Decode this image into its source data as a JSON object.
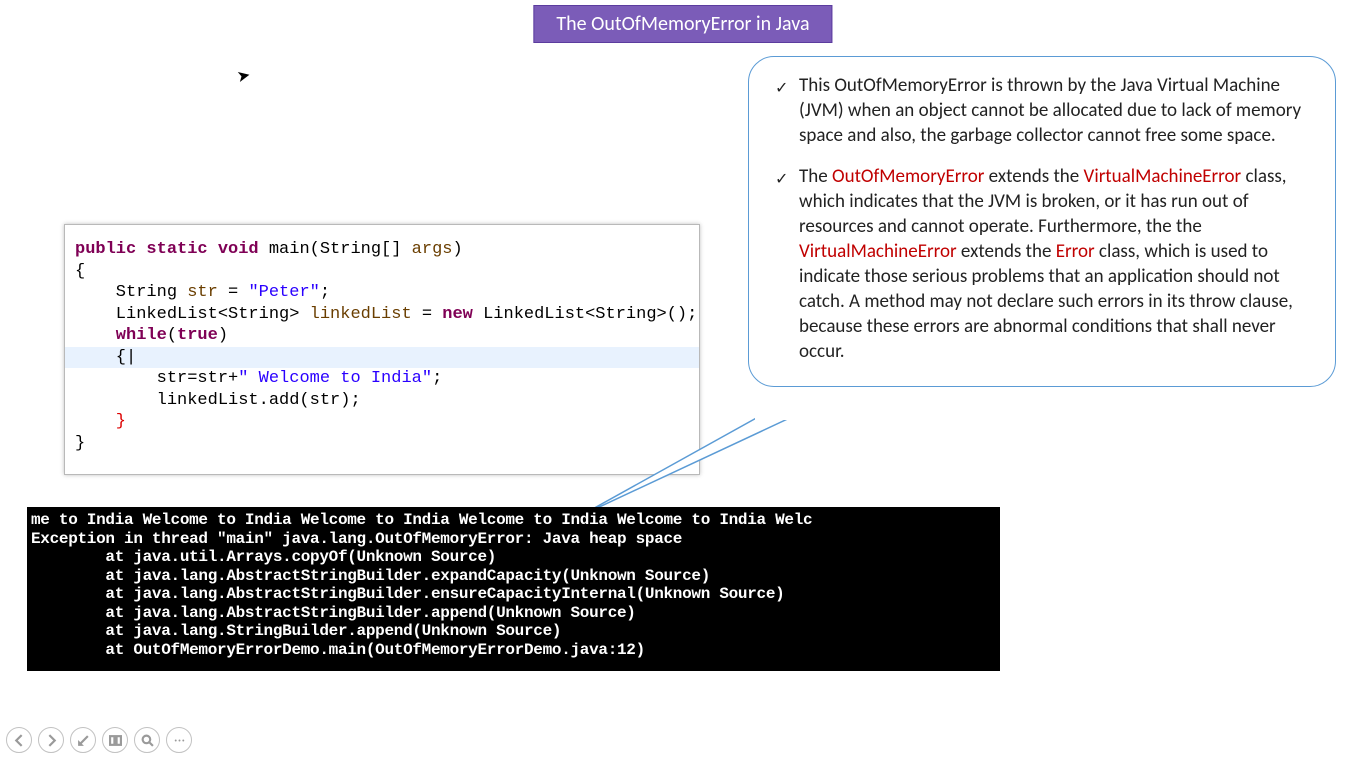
{
  "title": "The OutOfMemoryError in Java",
  "code": {
    "l1_kw": "public static void",
    "l1_b": " main(String[] ",
    "l1_par": "args",
    "l1_c": ")",
    "l2": "{",
    "l3_a": "    String ",
    "l3_par": "str",
    "l3_b": " = ",
    "l3_str": "\"Peter\"",
    "l3_c": ";",
    "l4_a": "    LinkedList<String> ",
    "l4_par": "linkedList",
    "l4_b": " = ",
    "l4_kw": "new",
    "l4_c": " LinkedList<String>();",
    "l5_kw": "    while",
    "l5_a": "(",
    "l5_kw2": "true",
    "l5_b": ")",
    "l6": "    {",
    "l7_a": "        str=str+",
    "l7_str": "\" Welcome to India\"",
    "l7_b": ";",
    "l8": "        linkedList.add(str);",
    "l9": "    }",
    "l10": "}"
  },
  "callout": {
    "p1": "This OutOfMemoryError is thrown by the Java Virtual Machine (JVM) when an object cannot be allocated due to lack of memory space and also, the garbage collector cannot free some space.",
    "p2_a": "The ",
    "p2_red1": "OutOfMemoryError",
    "p2_b": " extends the ",
    "p2_red2": "VirtualMachineError",
    "p2_c": " class, which indicates that the JVM is broken, or it has run out of resources and cannot operate. Furthermore, the the ",
    "p2_red3": "VirtualMachineError",
    "p2_d": " extends the ",
    "p2_red4": "Error",
    "p2_e": " class, which is used to indicate those serious problems that an application should not catch. A method may not declare such errors in its throw clause, because these errors are abnormal conditions that shall never occur."
  },
  "console_lines": [
    "me to India Welcome to India Welcome to India Welcome to India Welcome to India Welc",
    "Exception in thread \"main\" java.lang.OutOfMemoryError: Java heap space",
    "        at java.util.Arrays.copyOf(Unknown Source)",
    "        at java.lang.AbstractStringBuilder.expandCapacity(Unknown Source)",
    "        at java.lang.AbstractStringBuilder.ensureCapacityInternal(Unknown Source)",
    "        at java.lang.AbstractStringBuilder.append(Unknown Source)",
    "        at java.lang.StringBuilder.append(Unknown Source)",
    "        at OutOfMemoryErrorDemo.main(OutOfMemoryErrorDemo.java:12)"
  ]
}
